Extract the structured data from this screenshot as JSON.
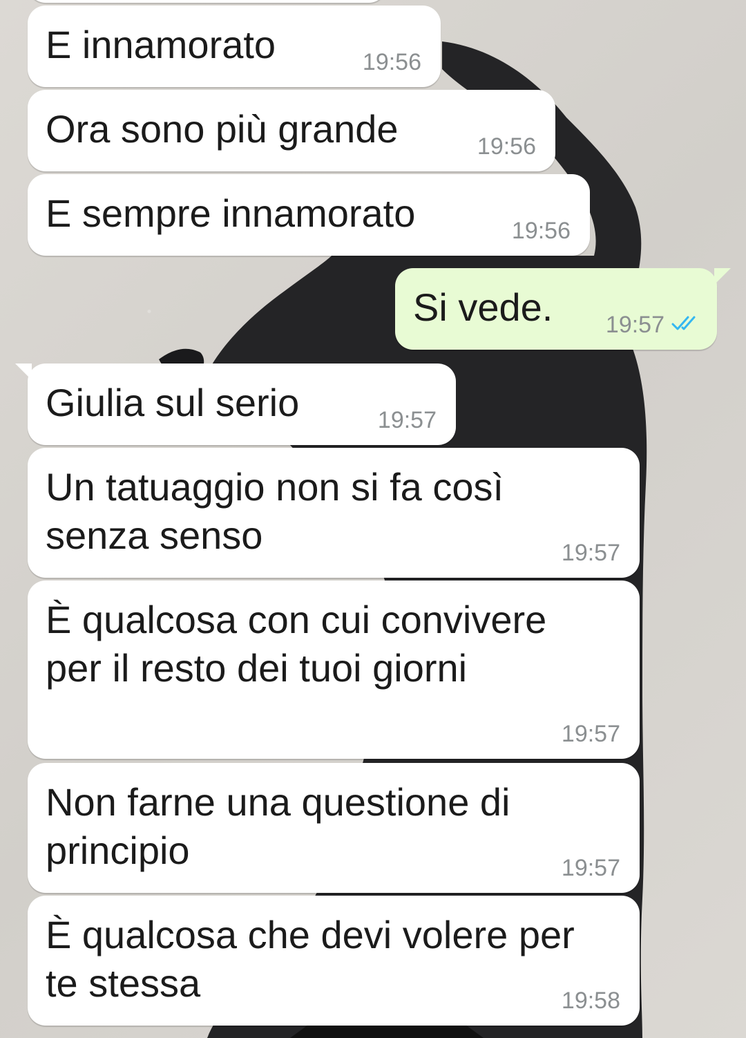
{
  "messages": [
    {
      "text": "E innamorato",
      "time": "19:56"
    },
    {
      "text": "Ora sono più grande",
      "time": "19:56"
    },
    {
      "text": "E sempre innamorato",
      "time": "19:56"
    },
    {
      "text": "Si vede.",
      "time": "19:57",
      "status_icon": "double-check-read-icon"
    },
    {
      "text": "Giulia sul serio",
      "time": "19:57"
    },
    {
      "text": "Un tatuaggio non si fa così\nsenza senso",
      "time": "19:57"
    },
    {
      "text": "È qualcosa con cui convivere\nper il resto dei tuoi giorni",
      "time": "19:57"
    },
    {
      "text": "Non farne una questione di\nprincipio",
      "time": "19:57"
    },
    {
      "text": "È qualcosa che devi volere per\nte stessa",
      "time": "19:58"
    }
  ],
  "colors": {
    "incoming_bubble": "#ffffff",
    "outgoing_bubble": "#e8fbd4",
    "timestamp": "#8b8f91",
    "read_ticks": "#34b7f1",
    "wallpaper": "#d9d6d1"
  }
}
